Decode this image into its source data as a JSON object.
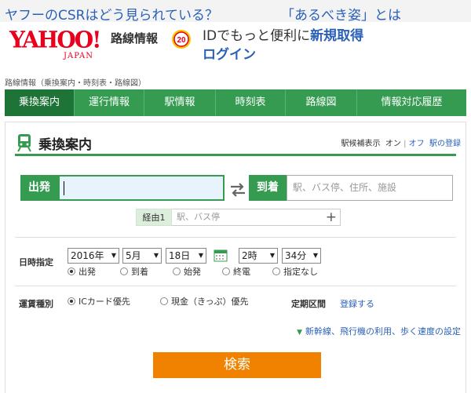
{
  "banner": {
    "link1": "ヤフーのCSRはどう見られている？",
    "link2": "「あるべき姿」とは"
  },
  "header": {
    "logo_text": "YAHOO!",
    "logo_sub": "JAPAN",
    "service_name": "路線情報",
    "badge_text": "20",
    "promo_text": "IDでもっと便利に",
    "signup_link": "新規取得",
    "login_link": "ログイン"
  },
  "breadcrumb": "路線情報（乗換案内・時刻表・路線図）",
  "nav": {
    "tabs": [
      {
        "label": "乗換案内"
      },
      {
        "label": "運行情報"
      },
      {
        "label": "駅情報"
      },
      {
        "label": "時刻表"
      },
      {
        "label": "路線図"
      },
      {
        "label": "情報対応履歴"
      }
    ]
  },
  "panel": {
    "title": "乗換案内",
    "candidates_label": "駅候補表示",
    "on_label": "オン",
    "off_label": "オフ",
    "station_register": "駅の登録"
  },
  "route": {
    "depart_label": "出発",
    "depart_value": "",
    "arrive_label": "到着",
    "arrive_placeholder": "駅、バス停、住所、施設",
    "via_label": "経由1",
    "via_placeholder": "駅、バス停",
    "add_via": "+"
  },
  "datetime": {
    "label": "日時指定",
    "year": "2016年",
    "month": "5月",
    "day": "18日",
    "hour": "2時",
    "minute": "34分",
    "options": [
      "出発",
      "到着",
      "始発",
      "終電",
      "指定なし"
    ],
    "selected": "出発"
  },
  "fare": {
    "label": "運賃種別",
    "options": [
      "ICカード優先",
      "現金（きっぷ）優先"
    ],
    "selected": "ICカード優先",
    "commuter_label": "定期区間",
    "commuter_link": "登録する"
  },
  "settings_link": "新幹線、飛行機の利用、歩く速度の設定",
  "search_button": "検索",
  "colors": {
    "green": "#349b50",
    "green_dark": "#1e7436",
    "orange": "#f08200",
    "link_blue": "#2a60b8",
    "yahoo_red": "#e8001c"
  }
}
